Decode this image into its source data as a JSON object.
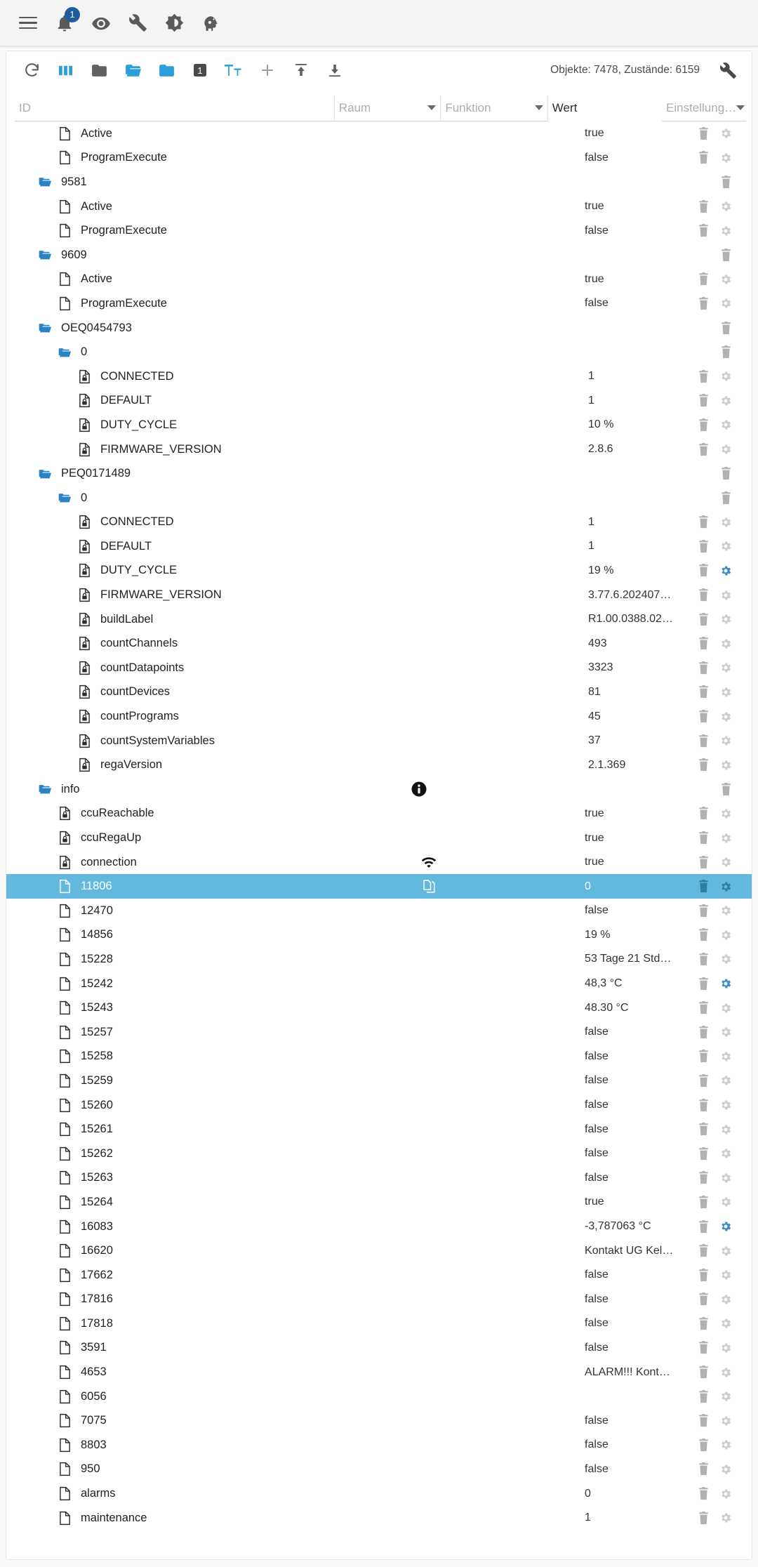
{
  "appbar": {
    "menu_label": "menu",
    "notification_badge": "1",
    "items": [
      {
        "icon": "hamburger-menu-icon",
        "name": "menu-button"
      },
      {
        "icon": "bell-icon",
        "name": "notifications-button"
      },
      {
        "icon": "eye-icon",
        "name": "visibility-button"
      },
      {
        "icon": "wrench-icon",
        "name": "tools-button"
      },
      {
        "icon": "brightness-icon",
        "name": "theme-button"
      },
      {
        "icon": "expert-head-icon",
        "name": "expert-mode-button"
      }
    ]
  },
  "toolbar": {
    "status_text": "Objekte: 7478, Zustände: 6159",
    "buttons": [
      {
        "name": "refresh-button",
        "icon": "refresh-icon"
      },
      {
        "name": "columns-button",
        "icon": "columns-icon"
      },
      {
        "name": "collapse-all-button",
        "icon": "folder-closed-icon"
      },
      {
        "name": "expand-all-button",
        "icon": "folder-open-icon"
      },
      {
        "name": "folder-button",
        "icon": "folder-filled-icon"
      },
      {
        "name": "expand-level-button",
        "icon": "level-one-icon",
        "text": "1"
      },
      {
        "name": "text-size-button",
        "icon": "text-size-icon",
        "text": "Tт"
      },
      {
        "name": "add-object-button",
        "icon": "plus-icon"
      },
      {
        "name": "import-button",
        "icon": "upload-icon"
      },
      {
        "name": "export-button",
        "icon": "download-icon"
      },
      {
        "name": "settings-button",
        "icon": "wrench-icon"
      }
    ]
  },
  "filters": {
    "id": {
      "placeholder": "ID",
      "value": ""
    },
    "raum": {
      "placeholder": "Raum",
      "value": ""
    },
    "funktion": {
      "placeholder": "Funktion",
      "value": ""
    },
    "wert": {
      "label": "Wert"
    },
    "einstellung": {
      "placeholder": "Einstellung…",
      "value": ""
    }
  },
  "colors": {
    "accent": "#2b9fd8",
    "selected_row": "#63b8dd",
    "folder_blue": "#2b83c2",
    "badge_blue": "#1f5c9e",
    "gear_active": "#3d8fc4"
  },
  "rows": [
    {
      "id": "Active",
      "indent": 2,
      "icon": "document-icon",
      "value": "true",
      "gear": true,
      "gear_active": false,
      "del": true
    },
    {
      "id": "ProgramExecute",
      "indent": 2,
      "icon": "document-icon",
      "value": "false",
      "gear": true,
      "gear_active": false,
      "del": true
    },
    {
      "id": "9581",
      "indent": 1,
      "icon": "folder-open-icon",
      "value": "",
      "gear": false,
      "gear_active": false,
      "del": true
    },
    {
      "id": "Active",
      "indent": 2,
      "icon": "document-icon",
      "value": "true",
      "gear": true,
      "gear_active": false,
      "del": true
    },
    {
      "id": "ProgramExecute",
      "indent": 2,
      "icon": "document-icon",
      "value": "false",
      "gear": true,
      "gear_active": false,
      "del": true
    },
    {
      "id": "9609",
      "indent": 1,
      "icon": "folder-open-icon",
      "value": "",
      "gear": false,
      "gear_active": false,
      "del": true
    },
    {
      "id": "Active",
      "indent": 2,
      "icon": "document-icon",
      "value": "true",
      "gear": true,
      "gear_active": false,
      "del": true
    },
    {
      "id": "ProgramExecute",
      "indent": 2,
      "icon": "document-icon",
      "value": "false",
      "gear": true,
      "gear_active": false,
      "del": true
    },
    {
      "id": "OEQ0454793",
      "indent": 1,
      "icon": "folder-open-icon",
      "value": "",
      "gear": false,
      "gear_active": false,
      "del": true
    },
    {
      "id": "0",
      "indent": 2,
      "icon": "folder-open-icon",
      "value": "",
      "gear": false,
      "gear_active": false,
      "del": true
    },
    {
      "id": "CONNECTED",
      "indent": 3,
      "icon": "document-lock-icon",
      "value": "1",
      "gear": true,
      "gear_active": false,
      "del": true
    },
    {
      "id": "DEFAULT",
      "indent": 3,
      "icon": "document-lock-icon",
      "value": "1",
      "gear": true,
      "gear_active": false,
      "del": true
    },
    {
      "id": "DUTY_CYCLE",
      "indent": 3,
      "icon": "document-lock-icon",
      "value": "10 %",
      "gear": true,
      "gear_active": false,
      "del": true
    },
    {
      "id": "FIRMWARE_VERSION",
      "indent": 3,
      "icon": "document-lock-icon",
      "value": "2.8.6",
      "gear": true,
      "gear_active": false,
      "del": true
    },
    {
      "id": "PEQ0171489",
      "indent": 1,
      "icon": "folder-open-icon",
      "value": "",
      "gear": false,
      "gear_active": false,
      "del": true
    },
    {
      "id": "0",
      "indent": 2,
      "icon": "folder-open-icon",
      "value": "",
      "gear": false,
      "gear_active": false,
      "del": true
    },
    {
      "id": "CONNECTED",
      "indent": 3,
      "icon": "document-lock-icon",
      "value": "1",
      "gear": true,
      "gear_active": false,
      "del": true
    },
    {
      "id": "DEFAULT",
      "indent": 3,
      "icon": "document-lock-icon",
      "value": "1",
      "gear": true,
      "gear_active": false,
      "del": true
    },
    {
      "id": "DUTY_CYCLE",
      "indent": 3,
      "icon": "document-lock-icon",
      "value": "19 %",
      "gear": true,
      "gear_active": true,
      "del": true
    },
    {
      "id": "FIRMWARE_VERSION",
      "indent": 3,
      "icon": "document-lock-icon",
      "value": "3.77.6.202407…",
      "gear": true,
      "gear_active": false,
      "del": true
    },
    {
      "id": "buildLabel",
      "indent": 3,
      "icon": "document-lock-icon",
      "value": "R1.00.0388.02…",
      "gear": true,
      "gear_active": false,
      "del": true
    },
    {
      "id": "countChannels",
      "indent": 3,
      "icon": "document-lock-icon",
      "value": "493",
      "gear": true,
      "gear_active": false,
      "del": true
    },
    {
      "id": "countDatapoints",
      "indent": 3,
      "icon": "document-lock-icon",
      "value": "3323",
      "gear": true,
      "gear_active": false,
      "del": true
    },
    {
      "id": "countDevices",
      "indent": 3,
      "icon": "document-lock-icon",
      "value": "81",
      "gear": true,
      "gear_active": false,
      "del": true
    },
    {
      "id": "countPrograms",
      "indent": 3,
      "icon": "document-lock-icon",
      "value": "45",
      "gear": true,
      "gear_active": false,
      "del": true
    },
    {
      "id": "countSystemVariables",
      "indent": 3,
      "icon": "document-lock-icon",
      "value": "37",
      "gear": true,
      "gear_active": false,
      "del": true
    },
    {
      "id": "regaVersion",
      "indent": 3,
      "icon": "document-lock-icon",
      "value": "2.1.369",
      "gear": true,
      "gear_active": false,
      "del": true
    },
    {
      "id": "info",
      "indent": 1,
      "icon": "folder-open-icon",
      "mid": "info-badge-icon",
      "value": "",
      "gear": false,
      "gear_active": false,
      "del": true
    },
    {
      "id": "ccuReachable",
      "indent": 2,
      "icon": "document-lock-icon",
      "value": "true",
      "gear": true,
      "gear_active": false,
      "del": true
    },
    {
      "id": "ccuRegaUp",
      "indent": 2,
      "icon": "document-lock-icon",
      "value": "true",
      "gear": true,
      "gear_active": false,
      "del": true
    },
    {
      "id": "connection",
      "indent": 2,
      "icon": "document-lock-icon",
      "mid": "wifi-icon",
      "value": "true",
      "gear": true,
      "gear_active": false,
      "del": true
    },
    {
      "id": "11806",
      "indent": 2,
      "icon": "document-icon",
      "mid": "copy-icon",
      "value": "0",
      "gear": true,
      "gear_active": true,
      "del": true,
      "selected": true
    },
    {
      "id": "12470",
      "indent": 2,
      "icon": "document-icon",
      "value": "false",
      "gear": true,
      "gear_active": false,
      "del": true
    },
    {
      "id": "14856",
      "indent": 2,
      "icon": "document-icon",
      "value": "19 %",
      "gear": true,
      "gear_active": false,
      "del": true
    },
    {
      "id": "15228",
      "indent": 2,
      "icon": "document-icon",
      "value": "53 Tage 21 Std…",
      "gear": true,
      "gear_active": false,
      "del": true
    },
    {
      "id": "15242",
      "indent": 2,
      "icon": "document-icon",
      "value": "48,3 °C",
      "gear": true,
      "gear_active": true,
      "del": true
    },
    {
      "id": "15243",
      "indent": 2,
      "icon": "document-icon",
      "value": "48.30 °C",
      "gear": true,
      "gear_active": false,
      "del": true
    },
    {
      "id": "15257",
      "indent": 2,
      "icon": "document-icon",
      "value": "false",
      "gear": true,
      "gear_active": false,
      "del": true
    },
    {
      "id": "15258",
      "indent": 2,
      "icon": "document-icon",
      "value": "false",
      "gear": true,
      "gear_active": false,
      "del": true
    },
    {
      "id": "15259",
      "indent": 2,
      "icon": "document-icon",
      "value": "false",
      "gear": true,
      "gear_active": false,
      "del": true
    },
    {
      "id": "15260",
      "indent": 2,
      "icon": "document-icon",
      "value": "false",
      "gear": true,
      "gear_active": false,
      "del": true
    },
    {
      "id": "15261",
      "indent": 2,
      "icon": "document-icon",
      "value": "false",
      "gear": true,
      "gear_active": false,
      "del": true
    },
    {
      "id": "15262",
      "indent": 2,
      "icon": "document-icon",
      "value": "false",
      "gear": true,
      "gear_active": false,
      "del": true
    },
    {
      "id": "15263",
      "indent": 2,
      "icon": "document-icon",
      "value": "false",
      "gear": true,
      "gear_active": false,
      "del": true
    },
    {
      "id": "15264",
      "indent": 2,
      "icon": "document-icon",
      "value": "true",
      "gear": true,
      "gear_active": false,
      "del": true
    },
    {
      "id": "16083",
      "indent": 2,
      "icon": "document-icon",
      "value": "-3,787063 °C",
      "gear": true,
      "gear_active": true,
      "del": true
    },
    {
      "id": "16620",
      "indent": 2,
      "icon": "document-icon",
      "value": "Kontakt UG Kel…",
      "gear": true,
      "gear_active": false,
      "del": true
    },
    {
      "id": "17662",
      "indent": 2,
      "icon": "document-icon",
      "value": "false",
      "gear": true,
      "gear_active": false,
      "del": true
    },
    {
      "id": "17816",
      "indent": 2,
      "icon": "document-icon",
      "value": "false",
      "gear": true,
      "gear_active": false,
      "del": true
    },
    {
      "id": "17818",
      "indent": 2,
      "icon": "document-icon",
      "value": "false",
      "gear": true,
      "gear_active": false,
      "del": true
    },
    {
      "id": "3591",
      "indent": 2,
      "icon": "document-icon",
      "value": "false",
      "gear": true,
      "gear_active": false,
      "del": true
    },
    {
      "id": "4653",
      "indent": 2,
      "icon": "document-icon",
      "value": "ALARM!!! Kont…",
      "gear": true,
      "gear_active": false,
      "del": true
    },
    {
      "id": "6056",
      "indent": 2,
      "icon": "document-icon",
      "value": "",
      "gear": true,
      "gear_active": false,
      "del": true
    },
    {
      "id": "7075",
      "indent": 2,
      "icon": "document-icon",
      "value": "false",
      "gear": true,
      "gear_active": false,
      "del": true
    },
    {
      "id": "8803",
      "indent": 2,
      "icon": "document-icon",
      "value": "false",
      "gear": true,
      "gear_active": false,
      "del": true
    },
    {
      "id": "950",
      "indent": 2,
      "icon": "document-icon",
      "value": "false",
      "gear": true,
      "gear_active": false,
      "del": true
    },
    {
      "id": "alarms",
      "indent": 2,
      "icon": "document-icon",
      "value": "0",
      "gear": true,
      "gear_active": false,
      "del": true
    },
    {
      "id": "maintenance",
      "indent": 2,
      "icon": "document-icon",
      "value": "1",
      "gear": true,
      "gear_active": false,
      "del": true
    }
  ]
}
